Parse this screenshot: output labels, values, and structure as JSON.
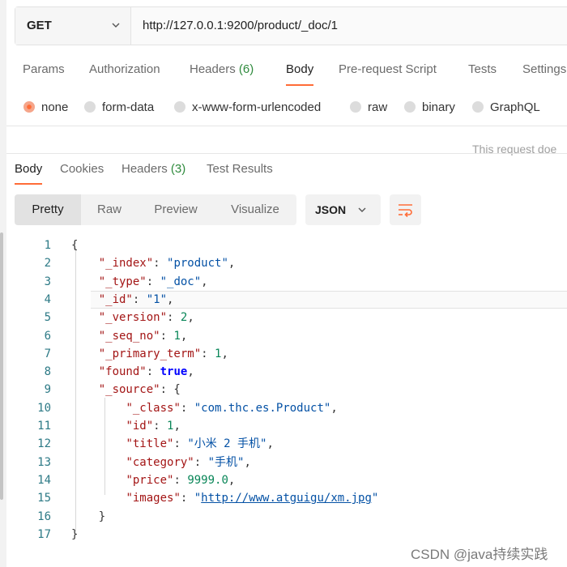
{
  "request": {
    "method": "GET",
    "url": "http://127.0.0.1:9200/product/_doc/1"
  },
  "request_tabs": [
    {
      "label": "Params"
    },
    {
      "label": "Authorization"
    },
    {
      "label": "Headers",
      "count": "(6)"
    },
    {
      "label": "Body",
      "active": true
    },
    {
      "label": "Pre-request Script"
    },
    {
      "label": "Tests"
    },
    {
      "label": "Settings"
    }
  ],
  "body_types": [
    {
      "label": "none",
      "selected": true
    },
    {
      "label": "form-data"
    },
    {
      "label": "x-www-form-urlencoded"
    },
    {
      "label": "raw"
    },
    {
      "label": "binary"
    },
    {
      "label": "GraphQL"
    }
  ],
  "hint": "This request doe",
  "response_tabs": [
    {
      "label": "Body",
      "active": true
    },
    {
      "label": "Cookies"
    },
    {
      "label": "Headers",
      "count": "(3)"
    },
    {
      "label": "Test Results"
    }
  ],
  "view_modes": [
    "Pretty",
    "Raw",
    "Preview",
    "Visualize"
  ],
  "format": "JSON",
  "code_lines": [
    {
      "n": "1",
      "text": "{"
    },
    {
      "n": "2",
      "text": "    \"_index\": \"product\","
    },
    {
      "n": "3",
      "text": "    \"_type\": \"_doc\","
    },
    {
      "n": "4",
      "text": "    \"_id\": \"1\","
    },
    {
      "n": "5",
      "text": "    \"_version\": 2,"
    },
    {
      "n": "6",
      "text": "    \"_seq_no\": 1,"
    },
    {
      "n": "7",
      "text": "    \"_primary_term\": 1,"
    },
    {
      "n": "8",
      "text": "    \"found\": true,"
    },
    {
      "n": "9",
      "text": "    \"_source\": {"
    },
    {
      "n": "10",
      "text": "        \"_class\": \"com.thc.es.Product\","
    },
    {
      "n": "11",
      "text": "        \"id\": 1,"
    },
    {
      "n": "12",
      "text": "        \"title\": \"小米 2 手机\","
    },
    {
      "n": "13",
      "text": "        \"category\": \"手机\","
    },
    {
      "n": "14",
      "text": "        \"price\": 9999.0,"
    },
    {
      "n": "15",
      "text": "        \"images\": \"http://www.atguigu/xm.jpg\""
    },
    {
      "n": "16",
      "text": "    }"
    },
    {
      "n": "17",
      "text": "}"
    }
  ],
  "watermark": "CSDN @java持续实践",
  "colors": {
    "accent": "#ff6c37",
    "count": "#2e8a3c",
    "key": "#a31515",
    "string": "#0451a5",
    "number": "#098658"
  }
}
